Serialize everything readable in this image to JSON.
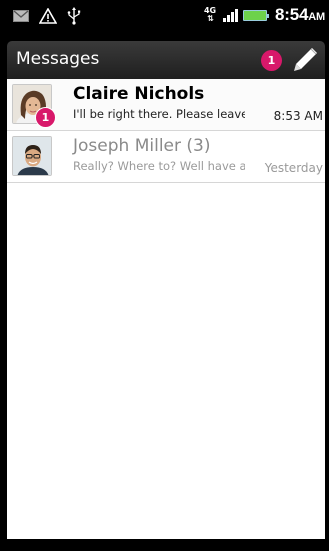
{
  "status_bar": {
    "network_type": "4G",
    "network_arrows": "⇅",
    "time": "8:54",
    "ampm": "AM",
    "battery_color": "#6dd24b",
    "icons": [
      "gmail-icon",
      "warning-icon",
      "usb-icon"
    ]
  },
  "header": {
    "title": "Messages",
    "unread_badge": "1",
    "compose_icon": "pencil-icon"
  },
  "threads": [
    {
      "name": "Claire Nichols",
      "snippet": "I'll be right there. Please leave n",
      "time": "8:53 AM",
      "unread": true,
      "unread_count": "1"
    },
    {
      "name": "Joseph Miller (3)",
      "snippet": "Really? Where to? Well have a",
      "time": "Yesterday",
      "unread": false
    }
  ],
  "colors": {
    "badge": "#d8186a",
    "title_bar": "#2a2a2a"
  }
}
